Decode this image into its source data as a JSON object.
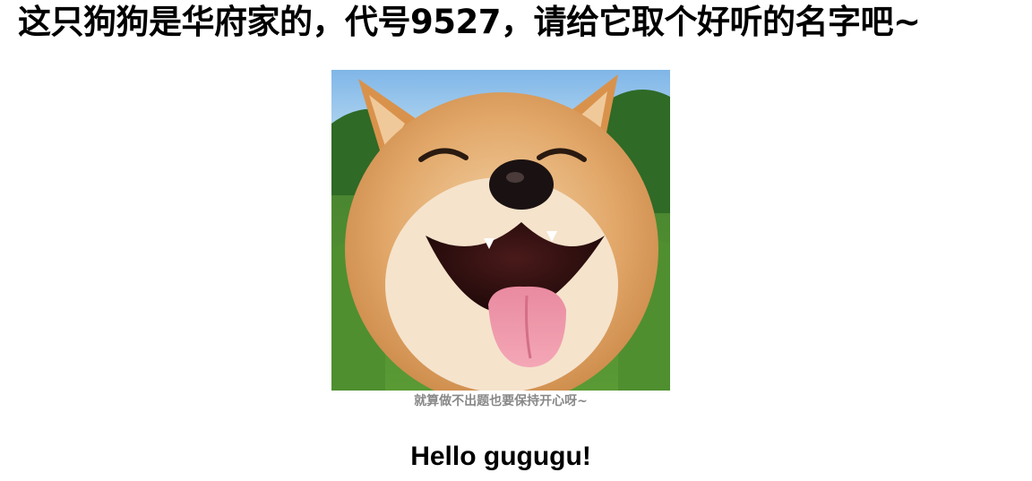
{
  "header": {
    "title": "这只狗狗是华府家的，代号9527，请给它取个好听的名字吧~"
  },
  "photo": {
    "icon": "shiba-dog-photo"
  },
  "caption": {
    "text": "就算做不出题也要保持开心呀~"
  },
  "greeting": {
    "text": "Hello gugugu!"
  }
}
